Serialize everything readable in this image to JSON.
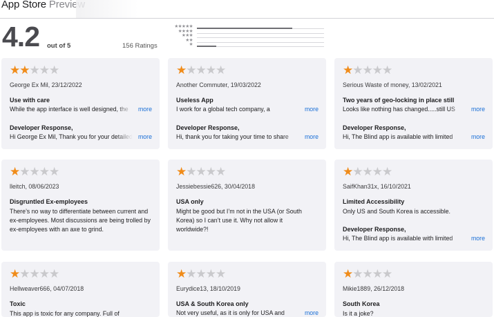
{
  "header": {
    "store_label": "App Store",
    "preview_label": "Preview"
  },
  "summary": {
    "rating": "4.2",
    "out_of": "out of 5",
    "count": "156 Ratings",
    "histogram": [
      {
        "stars": "★★★★★",
        "fraction": 0.75
      },
      {
        "stars": "★★★★",
        "fraction": 0.0
      },
      {
        "stars": "★★★",
        "fraction": 0.0
      },
      {
        "stars": "★★",
        "fraction": 0.0
      },
      {
        "stars": "★",
        "fraction": 0.15
      }
    ]
  },
  "colors": {
    "star": "#f08c1a",
    "link": "#1a6fd6",
    "card": "#f2f2f6"
  },
  "reviews": [
    {
      "rating": 2,
      "stars_on": "★★",
      "stars_off": "★★★",
      "meta": "George Ex Mil, 23/12/2022",
      "title": "Use with care",
      "body_line": "While the app interface is well designed, the",
      "more": "more",
      "dev_label": "Developer Response,",
      "dev_line": "Hi George Ex Mil, Thank you for your detailed",
      "dev_more": "more"
    },
    {
      "rating": 1,
      "stars_on": "★",
      "stars_off": "★★★★",
      "meta": "Another Commuter, 19/03/2022",
      "title": "Useless App",
      "body_line": "I work for a global tech company, a",
      "more": "more",
      "dev_label": "Developer Response,",
      "dev_line": "Hi, thank you for taking your time to share",
      "dev_more": "more"
    },
    {
      "rating": 1,
      "stars_on": "★",
      "stars_off": "★★★★",
      "meta": "Serious Waste of money, 13/02/2021",
      "title": "Two years of geo-locking in place still",
      "body_line": "Looks like nothing has changed.....still US",
      "more": "more",
      "dev_label": "Developer Response,",
      "dev_line": "Hi, The Blind app is available with limited",
      "dev_more": "more"
    },
    {
      "rating": 1,
      "stars_on": "★",
      "stars_off": "★★★★",
      "meta": "lleitch, 08/06/2023",
      "title": "Disgruntled Ex-employees",
      "body": "There’s no way to differentiate between current and ex-employees. Most discussions are being trolled by ex-employees with an axe to grind."
    },
    {
      "rating": 1,
      "stars_on": "★",
      "stars_off": "★★★★",
      "meta": "Jessiebessie626, 30/04/2018",
      "title": "USA only",
      "body": "Might be good but I’m not in the USA (or South Korea) so I can’t use it. Why not allow it worldwide?!"
    },
    {
      "rating": 1,
      "stars_on": "★",
      "stars_off": "★★★★",
      "meta": "SaifKhan31x, 16/10/2021",
      "title": "Limited Accessibility",
      "body": "Only US and South Korea is accessible.",
      "dev_label": "Developer Response,",
      "dev_line": "Hi, The Blind app is available with limited",
      "dev_more": "more"
    },
    {
      "rating": 1,
      "stars_on": "★",
      "stars_off": "★★★★",
      "meta": "Hellweaver666, 04/07/2018",
      "title": "Toxic",
      "body_line": "This app is toxic for any company. Full of"
    },
    {
      "rating": 1,
      "stars_on": "★",
      "stars_off": "★★★★",
      "meta": "Eurydice13, 18/10/2019",
      "title": "USA & South Korea only",
      "body_line": "Not very useful, as it is only for USA and",
      "more": "more"
    },
    {
      "rating": 1,
      "stars_on": "★",
      "stars_off": "★★★★",
      "meta": "Mikie1889, 26/12/2018",
      "title": "South Korea",
      "body_line": "Is it a joke?"
    }
  ]
}
